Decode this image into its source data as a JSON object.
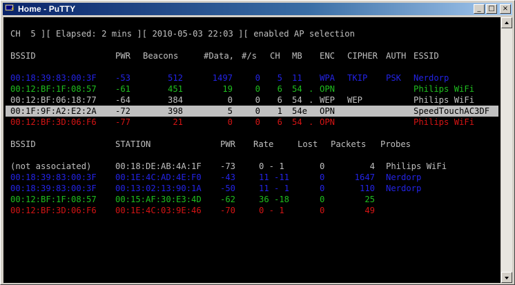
{
  "window": {
    "title": "Home - PuTTY"
  },
  "controls": {
    "minimize": "_",
    "maximize": "□",
    "close": "×"
  },
  "header_line": "CH  5 ][ Elapsed: 2 mins ][ 2010-05-03 22:03 ][ enabled AP selection",
  "ap_table": {
    "headers": [
      "BSSID",
      "PWR",
      "Beacons",
      "#Data,",
      "#/s",
      "CH",
      "MB",
      "ENC",
      "CIPHER",
      "AUTH",
      "ESSID"
    ],
    "rows": [
      {
        "color": "#2323e6",
        "bssid": "00:18:39:83:00:3F",
        "pwr": "-53",
        "beacons": "512",
        "data": "1497",
        "rate": "0",
        "ch": "5",
        "mb": "11",
        "dot": "",
        "enc": "WPA",
        "cipher": "TKIP",
        "auth": "PSK",
        "essid": "Nerdorp"
      },
      {
        "color": "#1fbf1f",
        "bssid": "00:12:BF:1F:08:57",
        "pwr": "-61",
        "beacons": "451",
        "data": "19",
        "rate": "0",
        "ch": "6",
        "mb": "54",
        "dot": ".",
        "enc": "OPN",
        "cipher": "",
        "auth": "",
        "essid": "Philips WiFi"
      },
      {
        "color": "#c0c0c0",
        "bssid": "00:12:BF:06:18:77",
        "pwr": "-64",
        "beacons": "384",
        "data": "0",
        "rate": "0",
        "ch": "6",
        "mb": "54",
        "dot": ".",
        "enc": "WEP",
        "cipher": "WEP",
        "auth": "",
        "essid": "Philips WiFi"
      },
      {
        "color": "#000000",
        "highlighted": true,
        "bssid": "00:1F:9F:A2:E2:2A",
        "pwr": "-72",
        "beacons": "398",
        "data": "5",
        "rate": "0",
        "ch": "1",
        "mb": "54e",
        "dot": "",
        "enc": "OPN",
        "cipher": "",
        "auth": "",
        "essid": "SpeedTouchAC3DF"
      },
      {
        "color": "#d41414",
        "bssid": "00:12:BF:3D:06:F6",
        "pwr": "-77",
        "beacons": "21",
        "data": "0",
        "rate": "0",
        "ch": "6",
        "mb": "54",
        "dot": ".",
        "enc": "OPN",
        "cipher": "",
        "auth": "",
        "essid": "Philips WiFi"
      }
    ]
  },
  "station_table": {
    "headers": [
      "BSSID",
      "STATION",
      "PWR",
      "Rate",
      "Lost",
      "Packets",
      "Probes"
    ],
    "rows": [
      {
        "color": "#c0c0c0",
        "bssid": "(not associated)",
        "station": "00:18:DE:AB:4A:1F",
        "pwr": "-73",
        "rate": "0 - 1",
        "lost": "0",
        "packets": "4",
        "probes": "Philips WiFi"
      },
      {
        "color": "#2323e6",
        "bssid": "00:18:39:83:00:3F",
        "station": "00:1E:4C:AD:4E:F0",
        "pwr": "-43",
        "rate": "11 -11",
        "lost": "0",
        "packets": "1647",
        "probes": "Nerdorp"
      },
      {
        "color": "#2323e6",
        "bssid": "00:18:39:83:00:3F",
        "station": "00:13:02:13:90:1A",
        "pwr": "-50",
        "rate": "11 - 1",
        "lost": "0",
        "packets": "110",
        "probes": "Nerdorp"
      },
      {
        "color": "#1fbf1f",
        "bssid": "00:12:BF:1F:08:57",
        "station": "00:15:AF:30:E3:4D",
        "pwr": "-62",
        "rate": "36 -18",
        "lost": "0",
        "packets": "25",
        "probes": ""
      },
      {
        "color": "#d41414",
        "bssid": "00:12:BF:3D:06:F6",
        "station": "00:1E:4C:03:9E:46",
        "pwr": "-70",
        "rate": "0 - 1",
        "lost": "0",
        "packets": "49",
        "probes": ""
      }
    ]
  }
}
